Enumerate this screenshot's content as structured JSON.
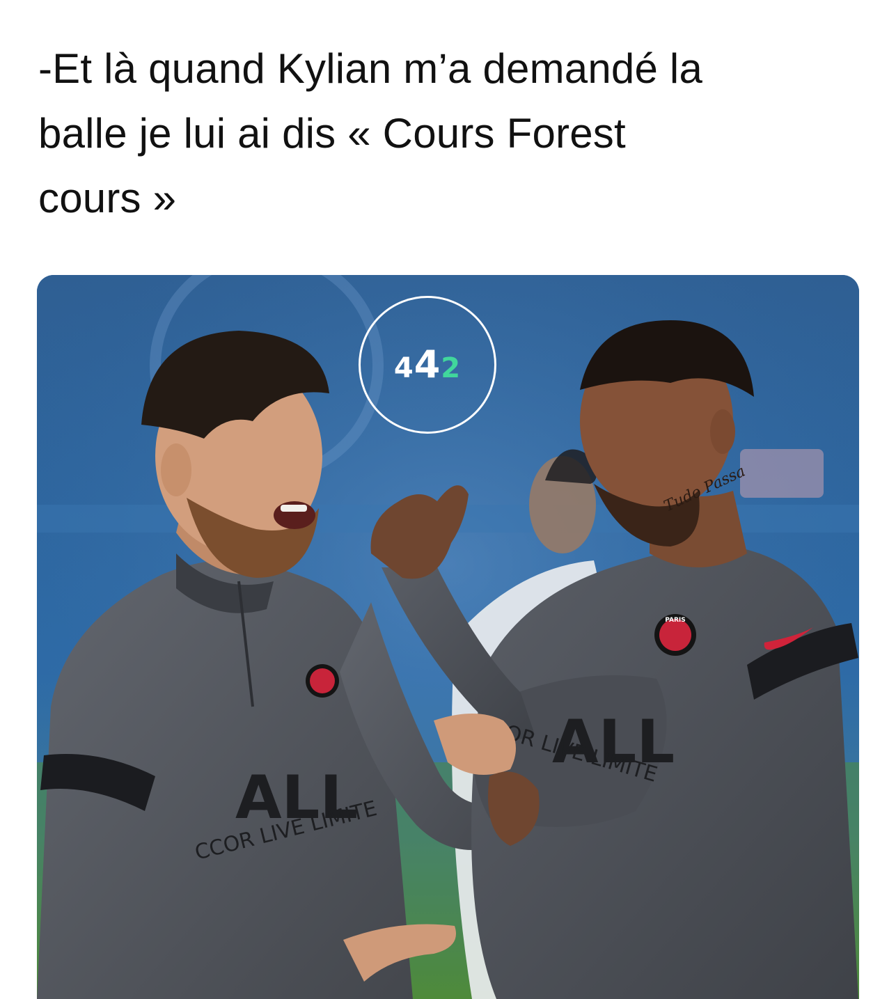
{
  "tweet": {
    "text_lines": [
      "-Et là quand Kylian m’a demandé la",
      "balle je lui ai dis « Cours Forest",
      "cours »"
    ]
  },
  "media": {
    "watermark": {
      "digit_1": "4",
      "digit_2": "4",
      "digit_3": "2"
    },
    "sponsor_text_left": "ALL",
    "sponsor_sub_left": "CCOR LIVE LIMITE",
    "sponsor_text_right": "ALL",
    "sponsor_sub_right": "COR LIVE LIMITE",
    "crest_text": "PARIS",
    "neck_tattoo": "Tudo Passa",
    "colors": {
      "background_blue": "#2d6aa6",
      "grass": "#4f8a3a",
      "shirt_grey": "#55585f",
      "watermark_green": "#41d79c",
      "crest_red": "#c8243a"
    }
  }
}
